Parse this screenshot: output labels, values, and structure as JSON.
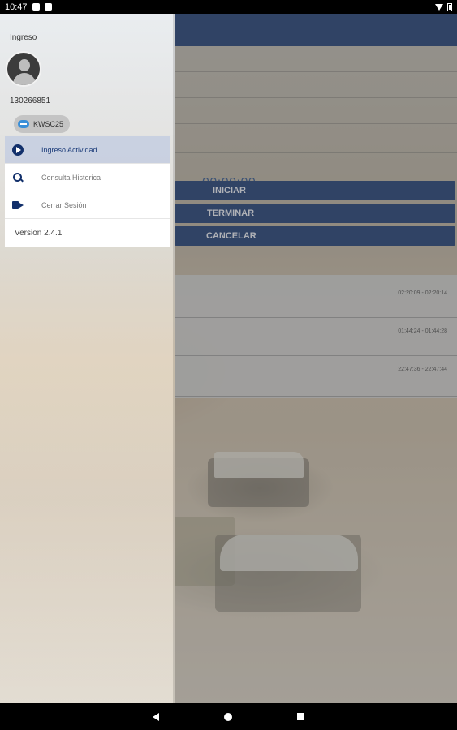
{
  "status_bar": {
    "time": "10:47"
  },
  "main": {
    "timer": "00:00:00",
    "buttons": {
      "start": "INICIAR",
      "finish": "TERMINAR",
      "cancel": "CANCELAR"
    },
    "history": [
      {
        "time_range": "02:20:09 - 02:20:14"
      },
      {
        "time_range": "01:44:24 - 01:44:28"
      },
      {
        "time_range": "22:47:36 - 22:47:44"
      }
    ]
  },
  "drawer": {
    "title": "Ingreso",
    "user_id": "130266851",
    "chip_label": "KWSC25",
    "menu": [
      {
        "label": "Ingreso Actividad",
        "icon": "play-icon",
        "active": true
      },
      {
        "label": "Consulta Historica",
        "icon": "search-icon",
        "active": false
      },
      {
        "label": "Cerrar Sesión",
        "icon": "logout-icon",
        "active": false
      }
    ],
    "version": "Version 2.4.1"
  },
  "colors": {
    "primary": "#0f2f6a",
    "accent_icon": "#12306b"
  }
}
